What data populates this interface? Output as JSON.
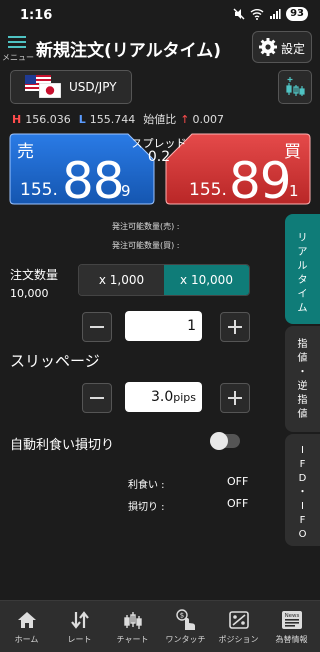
{
  "status_bar": {
    "time": "1:16",
    "battery": "93"
  },
  "header": {
    "menu_label": "メニュー",
    "title": "新規注文(リアルタイム)",
    "settings_label": "設定"
  },
  "pair": {
    "label": "USD/JPY"
  },
  "high_low": {
    "high_marker": "H",
    "high_value": "156.036",
    "low_marker": "L",
    "low_value": "155.744",
    "change_label": "始値比",
    "change_arrow": "↑",
    "change_value": "0.007"
  },
  "sell": {
    "label": "売",
    "prefix": "155.",
    "big": "88",
    "suffix": "9",
    "color": "#1f6fd6"
  },
  "buy": {
    "label": "買",
    "prefix": "155.",
    "big": "89",
    "suffix": "1",
    "color": "#d83a3a"
  },
  "spread": {
    "label": "スプレッド",
    "value": "0.2"
  },
  "available": {
    "sell_label": "発注可能数量(売) :",
    "buy_label": "発注可能数量(買) :"
  },
  "side_tabs": [
    {
      "label": "リアルタイム",
      "active": true
    },
    {
      "label": "指値・逆指値",
      "active": false
    },
    {
      "label": "IFD・IFO",
      "active": false
    }
  ],
  "quantity": {
    "label": "注文数量",
    "value_label": "10,000",
    "options": [
      "x 1,000",
      "x 10,000"
    ],
    "selected": "x 10,000",
    "field_value": "1"
  },
  "slippage": {
    "label": "スリッページ",
    "field_value": "3.0",
    "unit": "pips"
  },
  "auto_settle": {
    "label": "自動利食い損切り",
    "enabled": false,
    "take_profit_label": "利食い :",
    "take_profit_value": "OFF",
    "stop_loss_label": "損切り :",
    "stop_loss_value": "OFF"
  },
  "bottom_nav": [
    {
      "label": "ホーム",
      "icon": "home-icon"
    },
    {
      "label": "レート",
      "icon": "rate-icon"
    },
    {
      "label": "チャート",
      "icon": "chart-icon"
    },
    {
      "label": "ワンタッチ",
      "icon": "one-touch-icon"
    },
    {
      "label": "ポジション",
      "icon": "position-icon"
    },
    {
      "label": "為替情報",
      "icon": "news-icon",
      "badge": "News"
    }
  ],
  "colors": {
    "accent": "#0f7c78",
    "teal_icon": "#4fc3c3",
    "sell": "#1f6fd6",
    "buy": "#d83a3a"
  }
}
